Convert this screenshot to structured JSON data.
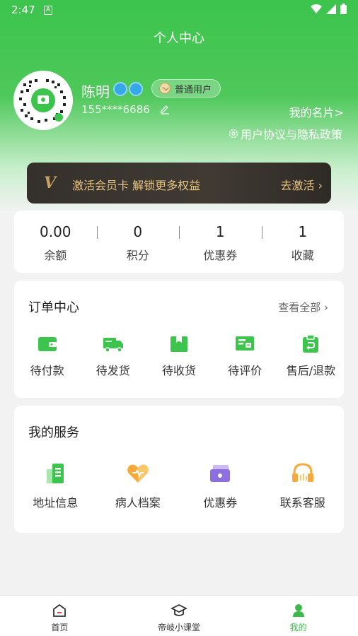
{
  "status_bar": {
    "time": "2:47",
    "notif_icon": "A"
  },
  "header": {
    "title": "个人中心"
  },
  "profile": {
    "name": "陈明",
    "level_badge": "普通用户",
    "phone": "155****6686",
    "card_link": "我的名片>",
    "privacy_link": "用户协议与隐私政策"
  },
  "vip": {
    "logo": "VIP",
    "text": "激活会员卡 解锁更多权益",
    "action": "去激活"
  },
  "stats": [
    {
      "value": "0.00",
      "label": "余额"
    },
    {
      "value": "0",
      "label": "积分"
    },
    {
      "value": "1",
      "label": "优惠券"
    },
    {
      "value": "1",
      "label": "收藏"
    }
  ],
  "orders": {
    "title": "订单中心",
    "view_all": "查看全部",
    "items": [
      {
        "label": "待付款",
        "icon": "wallet-icon"
      },
      {
        "label": "待发货",
        "icon": "truck-icon"
      },
      {
        "label": "待收货",
        "icon": "box-icon"
      },
      {
        "label": "待评价",
        "icon": "review-icon"
      },
      {
        "label": "售后/退款",
        "icon": "refund-icon"
      }
    ]
  },
  "services": {
    "title": "我的服务",
    "items": [
      {
        "label": "地址信息",
        "icon": "address-icon"
      },
      {
        "label": "病人档案",
        "icon": "heart-icon"
      },
      {
        "label": "优惠券",
        "icon": "coupon-icon"
      },
      {
        "label": "联系客服",
        "icon": "headset-icon"
      }
    ]
  },
  "tabbar": [
    {
      "label": "首页",
      "icon": "home-icon"
    },
    {
      "label": "帝岐小课堂",
      "icon": "graduation-cap-icon"
    },
    {
      "label": "我的",
      "icon": "person-icon",
      "active": true
    }
  ],
  "colors": {
    "brand_green": "#3cc44d",
    "vip_gold": "#e9c47d",
    "vip_dark": "#34302c"
  }
}
